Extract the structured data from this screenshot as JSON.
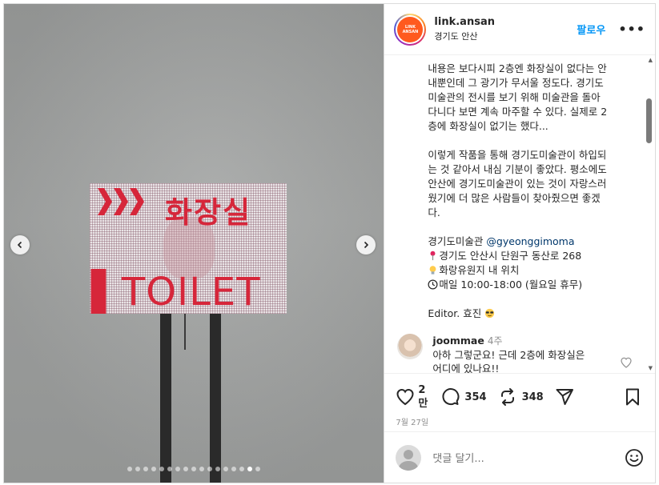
{
  "header": {
    "username": "link.ansan",
    "location": "경기도 안산",
    "avatar_text": "LINK ANSAN",
    "follow_label": "팔로우",
    "more_label": "•••"
  },
  "media": {
    "panel_text_kr": "화장실",
    "panel_text_en": "TOILET",
    "slide_count": 17,
    "active_slide": 16
  },
  "caption": {
    "p1": [
      "내용은 보다시피 2층엔 화장실이 없다는 안",
      "내뿐인데 그 광기가 무서울 정도다. 경기도",
      "미술관의 전시를 보기 위해 미술관을 돌아",
      "다니다 보면 계속 마주할 수 있다. 실제로 2",
      "층에 화장실이 없기는 했다..."
    ],
    "p2": [
      "이렇게 작품을 통해 경기도미술관이 하입되",
      "는 것 같아서 내심 기분이 좋았다. 평소에도",
      "안산에 경기도미술관이 있는 것이 자랑스러",
      "웠기에 더 많은 사람들이 찾아줬으면 좋겠",
      "다."
    ],
    "museum_name": "경기도미술관",
    "museum_handle": "@gyeonggimoma",
    "address": "경기도 안산시 단원구 동산로 268",
    "place": "화랑유원지 내 위치",
    "hours": "매일 10:00-18:00 (월요일 휴무)",
    "editor": "Editor. 효진"
  },
  "comment": {
    "username": "joommae",
    "time": "4주",
    "text_line1": "아하 그렇군요! 근데 2층에 화장실은",
    "text_line2": "어디에 있나요!!"
  },
  "actions": {
    "likes_line1": "2",
    "likes_line2": "만",
    "comments": "354",
    "reposts": "348",
    "date": "7월 27일"
  },
  "add_comment": {
    "placeholder": "댓글 달기..."
  },
  "colors": {
    "link_blue": "#0095f6",
    "mention": "#00376b",
    "panel_red": "#d6263a",
    "avatar_orange": "#ff5a1f"
  }
}
